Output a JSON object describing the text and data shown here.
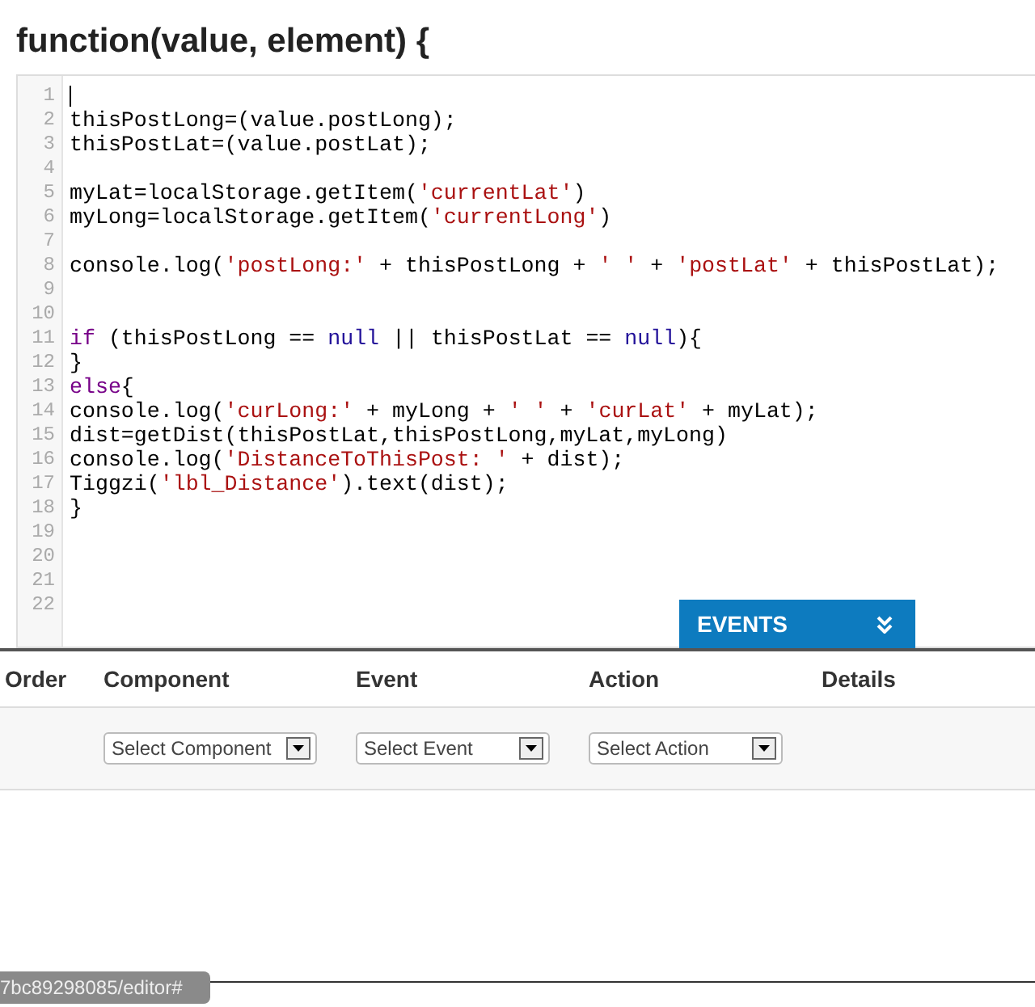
{
  "heading": "function(value, element) {",
  "code_lines": [
    {
      "number": "1",
      "cursor": true
    },
    {
      "number": "2",
      "cursor": false,
      "tokens": [
        {
          "kind": "plain",
          "text": "thisPostLong=(value.postLong);"
        }
      ]
    },
    {
      "number": "3",
      "cursor": false,
      "tokens": [
        {
          "kind": "plain",
          "text": "thisPostLat=(value.postLat);"
        }
      ]
    },
    {
      "number": "4",
      "cursor": false
    },
    {
      "number": "5",
      "cursor": false,
      "tokens": [
        {
          "kind": "plain",
          "text": "myLat=localStorage.getItem("
        },
        {
          "kind": "string",
          "text": "'currentLat'"
        },
        {
          "kind": "plain",
          "text": ")"
        }
      ]
    },
    {
      "number": "6",
      "cursor": false,
      "tokens": [
        {
          "kind": "plain",
          "text": "myLong=localStorage.getItem("
        },
        {
          "kind": "string",
          "text": "'currentLong'"
        },
        {
          "kind": "plain",
          "text": ")"
        }
      ]
    },
    {
      "number": "7",
      "cursor": false
    },
    {
      "number": "8",
      "cursor": false,
      "tokens": [
        {
          "kind": "plain",
          "text": "console.log("
        },
        {
          "kind": "string",
          "text": "'postLong:'"
        },
        {
          "kind": "plain",
          "text": " + thisPostLong + "
        },
        {
          "kind": "string",
          "text": "' '"
        },
        {
          "kind": "plain",
          "text": " + "
        },
        {
          "kind": "string",
          "text": "'postLat'"
        },
        {
          "kind": "plain",
          "text": " + thisPostLat);"
        }
      ]
    },
    {
      "number": "9",
      "cursor": false
    },
    {
      "number": "10",
      "cursor": false
    },
    {
      "number": "11",
      "cursor": false,
      "tokens": [
        {
          "kind": "keyword",
          "text": "if"
        },
        {
          "kind": "plain",
          "text": " (thisPostLong == "
        },
        {
          "kind": "atom",
          "text": "null"
        },
        {
          "kind": "plain",
          "text": " || thisPostLat == "
        },
        {
          "kind": "atom",
          "text": "null"
        },
        {
          "kind": "plain",
          "text": "){"
        }
      ]
    },
    {
      "number": "12",
      "cursor": false,
      "tokens": [
        {
          "kind": "plain",
          "text": "}"
        }
      ]
    },
    {
      "number": "13",
      "cursor": false,
      "tokens": [
        {
          "kind": "keyword",
          "text": "else"
        },
        {
          "kind": "plain",
          "text": "{"
        }
      ]
    },
    {
      "number": "14",
      "cursor": false,
      "tokens": [
        {
          "kind": "plain",
          "text": "console.log("
        },
        {
          "kind": "string",
          "text": "'curLong:'"
        },
        {
          "kind": "plain",
          "text": " + myLong + "
        },
        {
          "kind": "string",
          "text": "' '"
        },
        {
          "kind": "plain",
          "text": " + "
        },
        {
          "kind": "string",
          "text": "'curLat'"
        },
        {
          "kind": "plain",
          "text": " + myLat);"
        }
      ]
    },
    {
      "number": "15",
      "cursor": false,
      "tokens": [
        {
          "kind": "plain",
          "text": "dist=getDist(thisPostLat,thisPostLong,myLat,myLong)"
        }
      ]
    },
    {
      "number": "16",
      "cursor": false,
      "tokens": [
        {
          "kind": "plain",
          "text": "console.log("
        },
        {
          "kind": "string",
          "text": "'DistanceToThisPost: '"
        },
        {
          "kind": "plain",
          "text": " + dist);"
        }
      ]
    },
    {
      "number": "17",
      "cursor": false,
      "tokens": [
        {
          "kind": "plain",
          "text": "Tiggzi("
        },
        {
          "kind": "string",
          "text": "'lbl_Distance'"
        },
        {
          "kind": "plain",
          "text": ").text(dist);"
        }
      ]
    },
    {
      "number": "18",
      "cursor": false,
      "tokens": [
        {
          "kind": "plain",
          "text": "}"
        }
      ]
    },
    {
      "number": "19",
      "cursor": false
    },
    {
      "number": "20",
      "cursor": false
    },
    {
      "number": "21",
      "cursor": false
    },
    {
      "number": "22",
      "cursor": false
    }
  ],
  "events_tab": {
    "label": "EVENTS"
  },
  "events_table": {
    "columns": [
      "Order",
      "Component",
      "Event",
      "Action",
      "Details"
    ],
    "selects": [
      {
        "placeholder": "Select Component"
      },
      {
        "placeholder": "Select Event"
      },
      {
        "placeholder": "Select Action"
      }
    ]
  },
  "status_url": "7bc89298085/editor#"
}
